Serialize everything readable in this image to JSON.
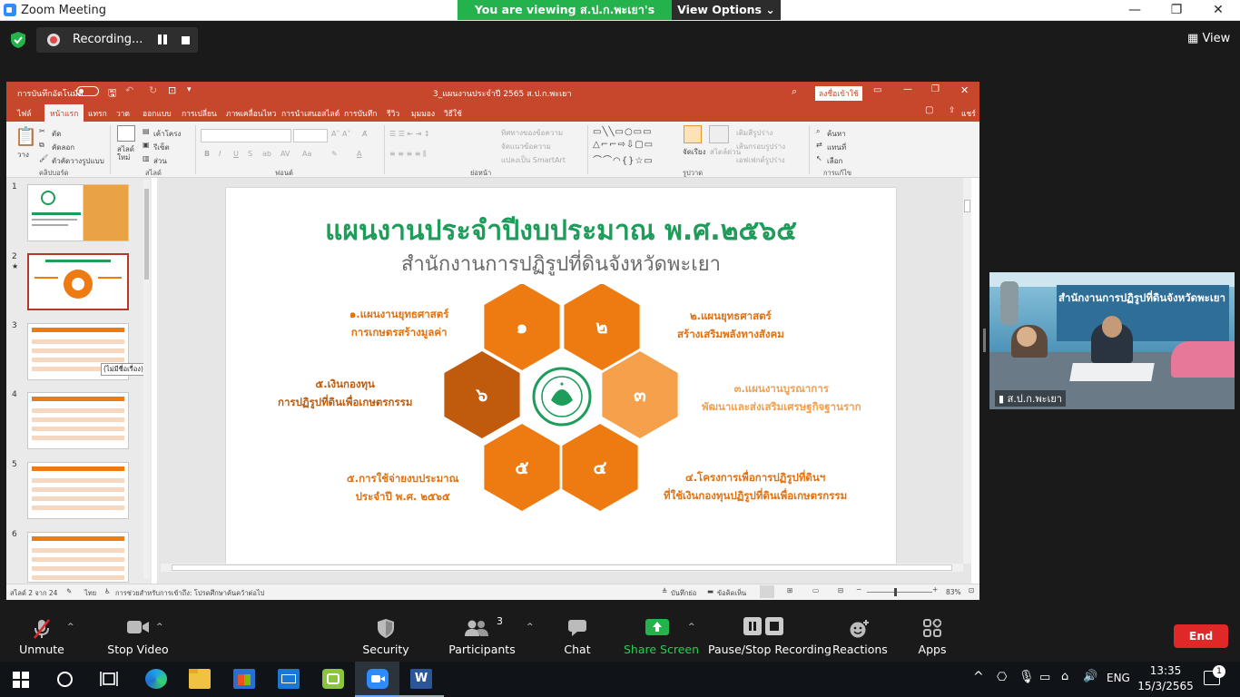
{
  "window": {
    "title": "Zoom Meeting"
  },
  "share_banner": {
    "viewing_text": "You are viewing ส.ป.ก.พะเยา's screen",
    "view_options": "View Options"
  },
  "top_bar": {
    "recording_label": "Recording...",
    "view_label": "View"
  },
  "ppt": {
    "autosave_label": "การบันทึกอัตโนมัติ",
    "filename": "3_แผนงานประจำปี 2565 ส.ป.ก.พะเยา",
    "signin": "ลงชื่อเข้าใช้",
    "tabs": [
      "ไฟล์",
      "หน้าแรก",
      "แทรก",
      "วาด",
      "ออกแบบ",
      "การเปลี่ยน",
      "ภาพเคลื่อนไหว",
      "การนำเสนอสไลด์",
      "การบันทึก",
      "รีวิว",
      "มุมมอง",
      "วิธีใช้"
    ],
    "share_label": "แชร์",
    "ribbon": {
      "paste": "วาง",
      "cut": "ตัด",
      "copy": "คัดลอก",
      "format_painter": "ตัวคัดวางรูปแบบ",
      "clipboard_group": "คลิปบอร์ด",
      "new_slide": "สไลด์ใหม่",
      "layout": "เค้าโครง",
      "reset": "รีเซ็ต",
      "section": "ส่วน",
      "slides_group": "สไลด์",
      "font_group": "ฟอนต์",
      "text_direction": "ทิศทางของข้อความ",
      "align_text": "จัดแนวข้อความ",
      "smartart": "แปลงเป็น SmartArt",
      "paragraph_group": "ย่อหน้า",
      "arrange": "จัดเรียง",
      "quick_styles": "สไตล์ด่วน",
      "shape_fill": "เติมสีรูปร่าง",
      "shape_outline": "เส้นกรอบรูปร่าง",
      "shape_effects": "เอฟเฟกต์รูปร่าง",
      "drawing_group": "รูปวาด",
      "find": "ค้นหา",
      "replace": "แทนที่",
      "select": "เลือก",
      "editing_group": "การแก้ไข"
    },
    "thumbnails": [
      "1",
      "2",
      "3",
      "4",
      "5",
      "6"
    ],
    "tooltip": "(ไม่มีชื่อเรื่อง)",
    "status": {
      "slide_count": "สไลด์ 2 จาก 24",
      "language": "ไทย",
      "accessibility": "การช่วยสำหรับการเข้าถึง: โปรดศึกษาค้นคว้าต่อไป",
      "notes": "บันทึกย่อ",
      "comments": "ข้อคิดเห็น",
      "zoom": "83%"
    }
  },
  "slide": {
    "title": "แผนงานประจำปีงบประมาณ พ.ศ.๒๕๖๕",
    "subtitle": "สำนักงานการปฏิรูปที่ดินจังหวัดพะเยา",
    "hex_numbers": [
      "๑",
      "๒",
      "๓",
      "๔",
      "๕",
      "๖"
    ],
    "items": [
      {
        "line1": "๑.แผนงานยุทธศาสตร์",
        "line2": "การเกษตรสร้างมูลค่า"
      },
      {
        "line1": "๒.แผนยุทธศาสตร์",
        "line2": "สร้างเสริมพลังทางสังคม"
      },
      {
        "line1": "๓.แผนงานบูรณาการ",
        "line2": "พัฒนาและส่งเสริมเศรษฐกิจฐานราก"
      },
      {
        "line1": "๔.โครงการเพื่อการปฏิรูปที่ดินฯ",
        "line2": "ที่ใช้เงินกองทุนปฏิรูปที่ดินเพื่อเกษตรกรรม"
      },
      {
        "line1": "๕.การใช้จ่ายงบประมาณ",
        "line2": "ประจำปี พ.ศ. ๒๕๖๕"
      },
      {
        "line1": "๕.เงินกองทุน",
        "line2": "การปฏิรูปที่ดินเพื่อเกษตรกรรม"
      }
    ],
    "colors": {
      "title": "#1e9c5a",
      "hex_dark": "#c05a0c",
      "hex_mid": "#ee7a12",
      "hex_light": "#f5a04a"
    }
  },
  "video": {
    "participant": "ส.ป.ก.พะเยา",
    "banner_text": "สำนักงานการปฏิรูปที่ดินจังหวัดพะเยา"
  },
  "toolbar": {
    "unmute": "Unmute",
    "stop_video": "Stop Video",
    "security": "Security",
    "participants": "Participants",
    "participants_count": "3",
    "chat": "Chat",
    "share_screen": "Share Screen",
    "pause_stop_recording": "Pause/Stop Recording",
    "reactions": "Reactions",
    "apps": "Apps",
    "end": "End"
  },
  "taskbar": {
    "language": "ENG",
    "time": "13:35",
    "date": "15/3/2565",
    "notifications": "1"
  }
}
